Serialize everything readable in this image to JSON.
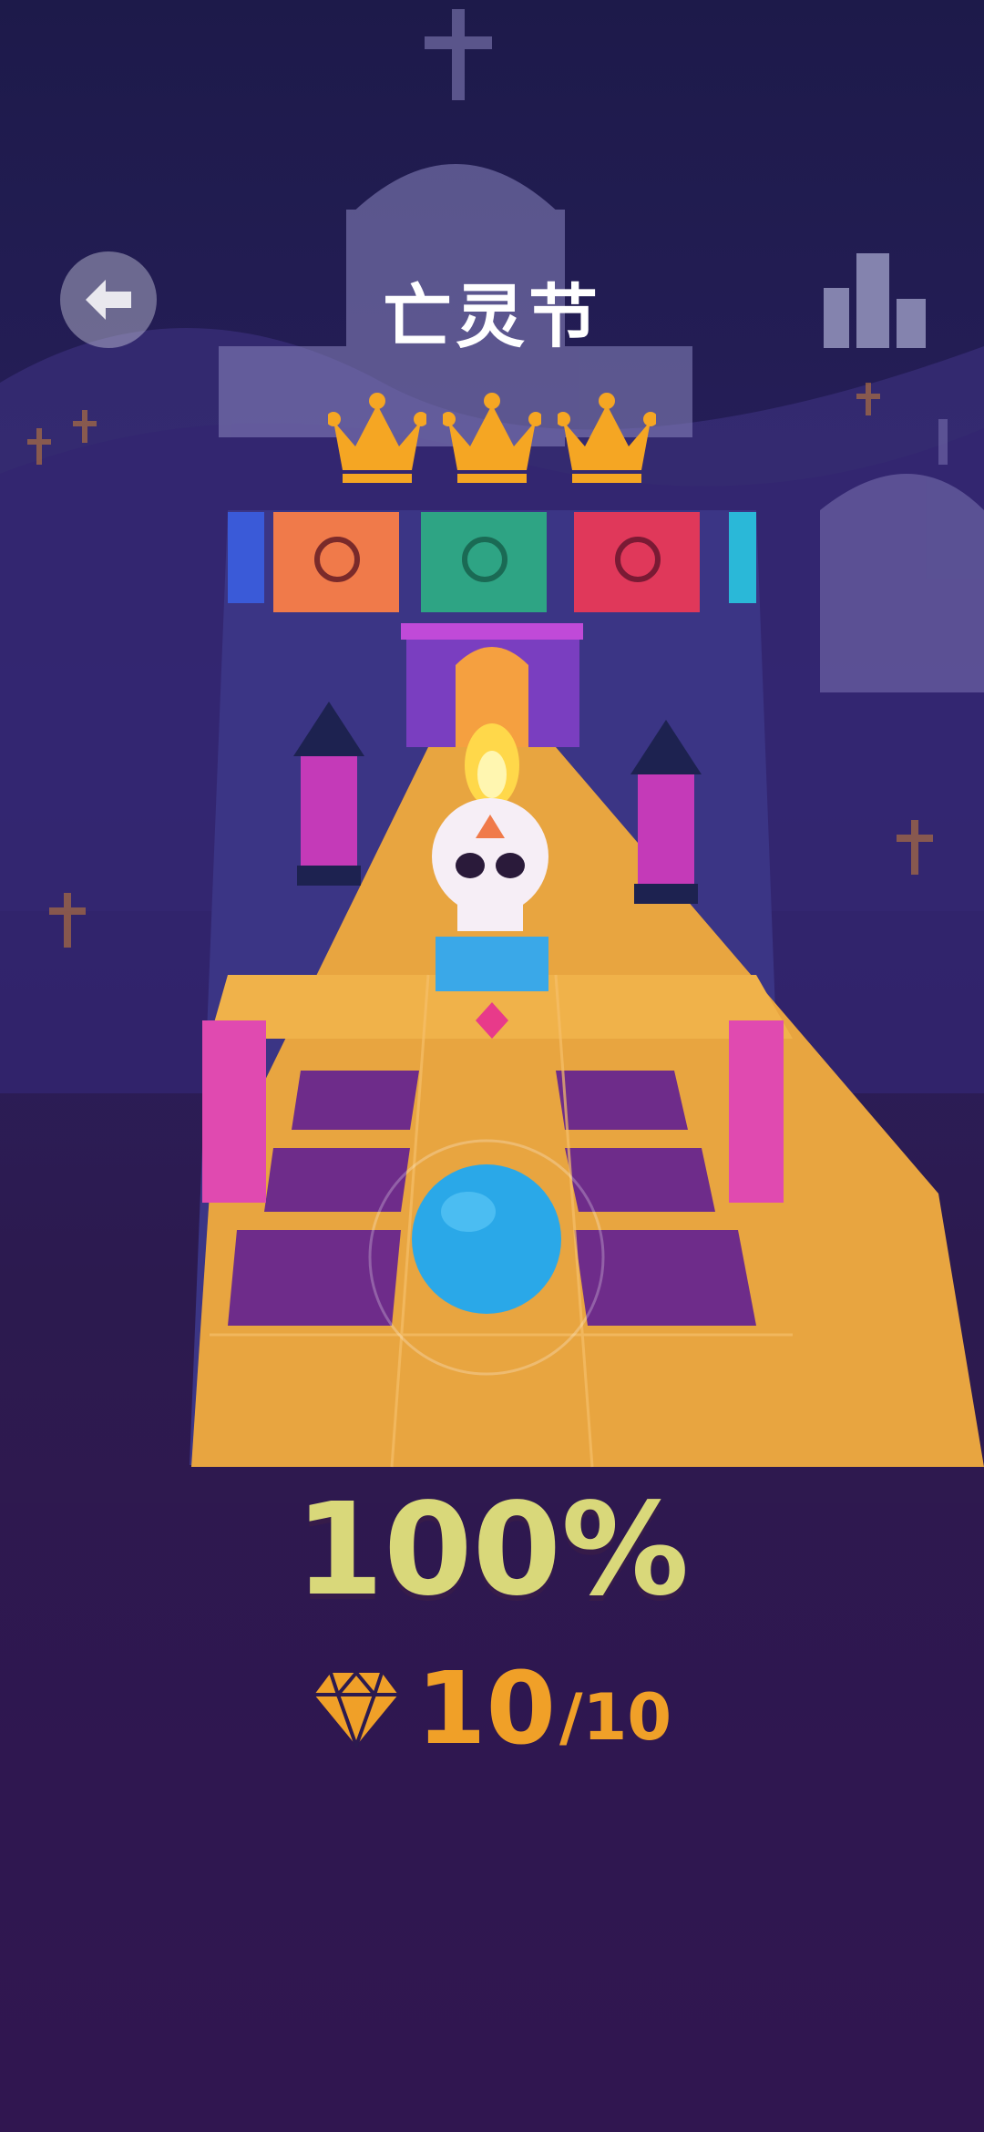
{
  "header": {
    "title": "亡灵节",
    "back_icon": "arrow-left-icon",
    "leaderboard_icon": "bar-chart-icon"
  },
  "level": {
    "crowns_earned": 3,
    "crowns_total": 3,
    "progress_label": "100%",
    "gems_collected": "10",
    "gems_separator": "/",
    "gems_total": "10"
  },
  "colors": {
    "accent_gold": "#f5a623",
    "percent_text": "#d9d87a",
    "gem_text": "#f0a028",
    "ball": "#2aa8e8"
  }
}
